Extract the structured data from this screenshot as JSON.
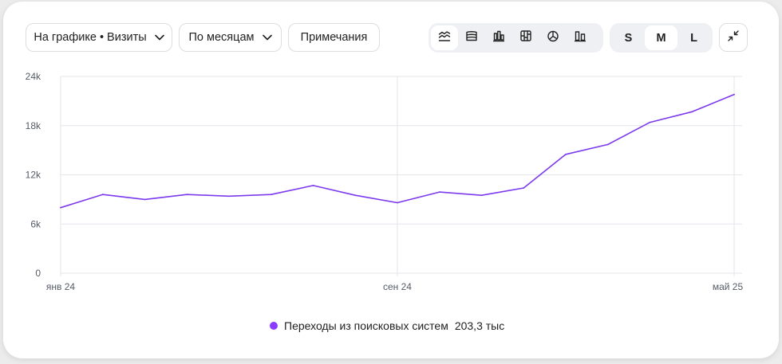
{
  "toolbar": {
    "metric_select_label": "На графике • Визиты",
    "period_select_label": "По месяцам",
    "notes_label": "Примечания",
    "chart_type_icons": [
      "line-chart-icon",
      "stacked-area-icon",
      "bar-chart-icon",
      "stacked-bar-icon",
      "pie-chart-icon",
      "grouped-bar-icon"
    ],
    "active_chart_type": 0,
    "sizes": [
      "S",
      "M",
      "L"
    ],
    "active_size": "M",
    "collapse_icon": "collapse-icon"
  },
  "colors": {
    "series": "#7c3aed",
    "legend_dot": "#8b3dff",
    "grid": "#e4e6ea",
    "axis_text": "#555b66"
  },
  "chart_data": {
    "type": "line",
    "x": [
      "2024-01",
      "2024-02",
      "2024-03",
      "2024-04",
      "2024-05",
      "2024-06",
      "2024-07",
      "2024-08",
      "2024-09",
      "2024-10",
      "2024-11",
      "2024-12",
      "2025-01",
      "2025-02",
      "2025-03",
      "2025-04",
      "2025-05"
    ],
    "x_tick_labels": [
      "янв 24",
      "сен 24",
      "май 25"
    ],
    "x_tick_indices": [
      0,
      8,
      16
    ],
    "y_tick_labels": [
      "0",
      "6k",
      "12k",
      "18k",
      "24k"
    ],
    "y_ticks": [
      0,
      6000,
      12000,
      18000,
      24000
    ],
    "ylim": [
      0,
      24000
    ],
    "grid": true,
    "legend_position": "bottom-center",
    "series": [
      {
        "name": "Переходы из поисковых систем",
        "total_label": "203,3 тыс",
        "values": [
          8000,
          9600,
          9000,
          9600,
          9400,
          9600,
          10700,
          9500,
          8600,
          9900,
          9500,
          10400,
          14500,
          15700,
          18400,
          19700,
          21800
        ]
      }
    ]
  }
}
